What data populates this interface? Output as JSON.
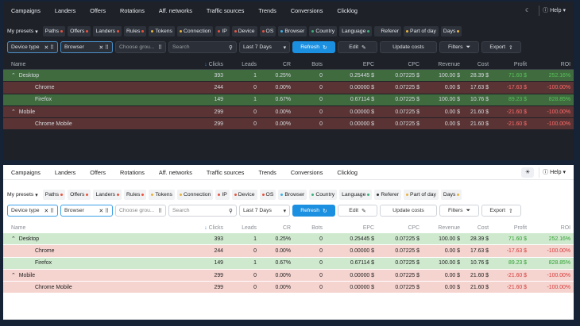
{
  "nav": {
    "items": [
      "Campaigns",
      "Landers",
      "Offers",
      "Rotations",
      "Aff. networks",
      "Traffic sources",
      "Trends",
      "Conversions",
      "Clicklog"
    ],
    "help": "Help"
  },
  "presets": {
    "label": "My presets",
    "chips": [
      {
        "label": "Paths",
        "dot": "#e8553f"
      },
      {
        "label": "Offers",
        "dot": "#e8553f"
      },
      {
        "label": "Landers",
        "dot": "#e8553f"
      },
      {
        "label": "Rules",
        "dot": "#e8553f"
      },
      {
        "label": "Tokens",
        "dot": "#e8b23f",
        "lead": true
      },
      {
        "label": "Connection",
        "dot": "#e8b23f",
        "lead": true
      },
      {
        "label": "IP",
        "dot": "#e8553f",
        "lead": true
      },
      {
        "label": "Device",
        "dot": "#e8553f",
        "lead": true
      },
      {
        "label": "OS",
        "dot": "#e8553f",
        "lead": true
      },
      {
        "label": "Browser",
        "dot": "#3fb0e8",
        "lead": true
      },
      {
        "label": "Country",
        "dot": "#3fb07a",
        "lead": true
      },
      {
        "label": "Language",
        "dot": "#3fb07a"
      },
      {
        "label": "Referer",
        "dot": "#333",
        "lead": true
      },
      {
        "label": "Part of day",
        "dot": "#e8b23f",
        "lead": true
      },
      {
        "label": "Days",
        "dot": "#e8b23f"
      }
    ]
  },
  "toolbar": {
    "group1": "Device type",
    "group2": "Browser",
    "group3": "Choose grou...",
    "search_placeholder": "Search",
    "date": "Last 7 Days",
    "refresh": "Refresh",
    "edit": "Edit",
    "update": "Update costs",
    "filters": "Filters",
    "export": "Export"
  },
  "table": {
    "headers": [
      "Name",
      "Clicks",
      "Leads",
      "CR",
      "Bots",
      "EPC",
      "CPC",
      "Revenue",
      "Cost",
      "Profit",
      "ROI"
    ],
    "rows": [
      {
        "name": "Desktop",
        "level": 0,
        "tone": "g",
        "sign": "pos",
        "cells": [
          "393",
          "1",
          "0.25%",
          "0",
          "0.25445 $",
          "0.07225 $",
          "100.00 $",
          "28.39 $",
          "71.60 $",
          "252.16%"
        ]
      },
      {
        "name": "Chrome",
        "level": 1,
        "tone": "r",
        "sign": "neg",
        "cells": [
          "244",
          "0",
          "0.00%",
          "0",
          "0.00000 $",
          "0.07225 $",
          "0.00 $",
          "17.63 $",
          "-17.63 $",
          "-100.00%"
        ]
      },
      {
        "name": "Firefox",
        "level": 1,
        "tone": "g",
        "sign": "pos",
        "cells": [
          "149",
          "1",
          "0.67%",
          "0",
          "0.67114 $",
          "0.07225 $",
          "100.00 $",
          "10.76 $",
          "89.23 $",
          "828.85%"
        ]
      },
      {
        "name": "Mobile",
        "level": 0,
        "tone": "r",
        "sign": "neg",
        "cells": [
          "299",
          "0",
          "0.00%",
          "0",
          "0.00000 $",
          "0.07225 $",
          "0.00 $",
          "21.60 $",
          "-21.60 $",
          "-100.00%"
        ]
      },
      {
        "name": "Chrome Mobile",
        "level": 1,
        "tone": "r",
        "sign": "neg",
        "cells": [
          "299",
          "0",
          "0.00%",
          "0",
          "0.00000 $",
          "0.07225 $",
          "0.00 $",
          "21.60 $",
          "-21.60 $",
          "-100.00%"
        ]
      }
    ]
  }
}
